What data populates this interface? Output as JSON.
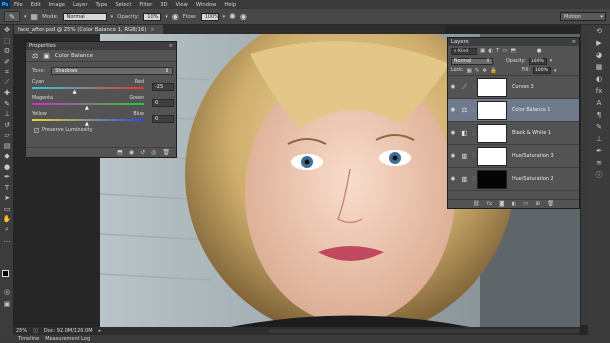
{
  "app": {
    "logo": "Ps"
  },
  "menu": [
    "File",
    "Edit",
    "Image",
    "Layer",
    "Type",
    "Select",
    "Filter",
    "3D",
    "View",
    "Window",
    "Help"
  ],
  "options": {
    "mode_label": "Mode:",
    "mode_value": "Normal",
    "opacity_label": "Opacity:",
    "opacity_value": "10%",
    "flow_label": "Flow:",
    "flow_value": "100%",
    "workspace": "Motion"
  },
  "document": {
    "tab_title": "face_after.psd @ 25% (Color Balance 1, RGB/16)"
  },
  "properties": {
    "title": "Properties",
    "adjustment_name": "Color Balance",
    "tone_label": "Tone:",
    "tone_value": "Shadows",
    "sliders": [
      {
        "left": "Cyan",
        "right": "Red",
        "value": "-25",
        "fraction": 0.39,
        "gradient": [
          "#2ec8d8",
          "#e23b2e"
        ]
      },
      {
        "left": "Magenta",
        "right": "Green",
        "value": "0",
        "fraction": 0.5,
        "gradient": [
          "#d02ec8",
          "#2ec83a"
        ]
      },
      {
        "left": "Yellow",
        "right": "Blue",
        "value": "0",
        "fraction": 0.5,
        "gradient": [
          "#e8d82a",
          "#2a4ae8"
        ]
      }
    ],
    "preserve_label": "Preserve Luminosity",
    "preserve_checked": true
  },
  "layers": {
    "title": "Layers",
    "kind_label": "Kind",
    "blend_mode": "Normal",
    "opacity_label": "Opacity:",
    "opacity_value": "100%",
    "lock_label": "Lock:",
    "fill_label": "Fill:",
    "fill_value": "100%",
    "items": [
      {
        "name": "Curves 3",
        "icon": "curves-icon",
        "mask": "white",
        "selected": false
      },
      {
        "name": "Color Balance 1",
        "icon": "balance-icon",
        "mask": "white",
        "selected": true
      },
      {
        "name": "Black & White 1",
        "icon": "half-circle-icon",
        "mask": "white",
        "selected": false
      },
      {
        "name": "Hue/Saturation 3",
        "icon": "hue-icon",
        "mask": "white",
        "selected": false
      },
      {
        "name": "Hue/Saturation 2",
        "icon": "hue-icon",
        "mask": "black",
        "selected": false
      }
    ]
  },
  "status": {
    "zoom": "25%",
    "doc": "Doc: 92.0M/120.0M"
  },
  "bottom_tabs": [
    "Timeline",
    "Measurement Log"
  ]
}
